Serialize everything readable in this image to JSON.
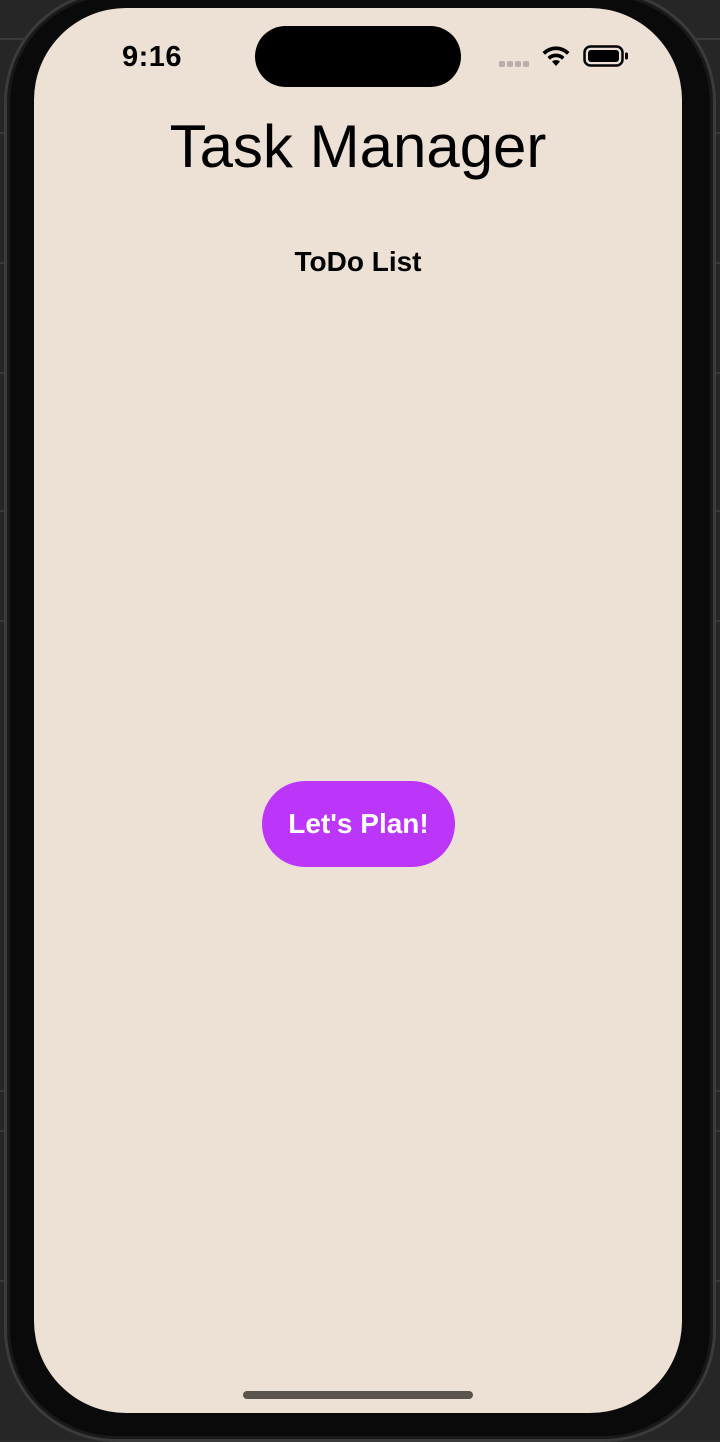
{
  "status_bar": {
    "time": "9:16",
    "wifi_icon": "wifi-icon",
    "battery_icon": "battery-icon",
    "signal_icon": "cellular-signal-icon"
  },
  "app": {
    "title": "Task Manager",
    "subtitle": "ToDo List",
    "primary_button_label": "Let's Plan!"
  },
  "colors": {
    "background": "#ede1d6",
    "accent": "#bc36fa",
    "button_text": "#ffffff",
    "text": "#000000"
  }
}
